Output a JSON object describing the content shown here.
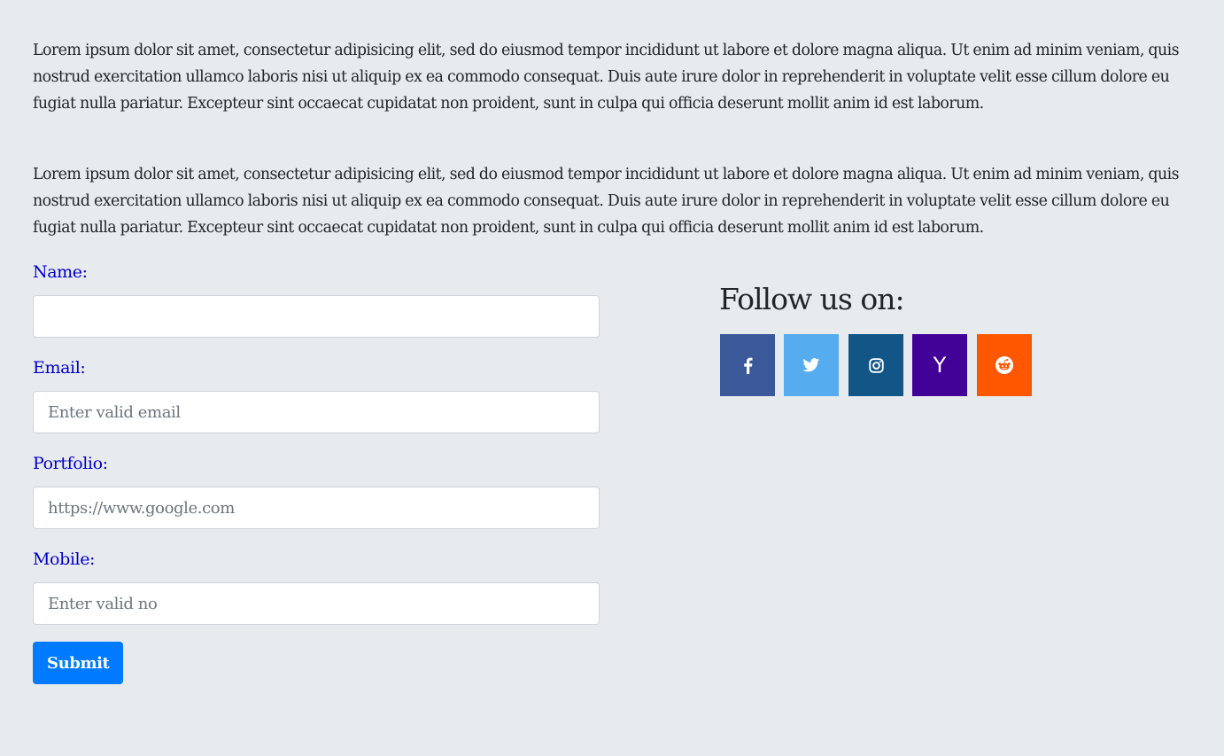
{
  "content": {
    "paragraph_1": "Lorem ipsum dolor sit amet, consectetur adipisicing elit, sed do eiusmod tempor incididunt ut labore et dolore magna aliqua. Ut enim ad minim veniam, quis nostrud exercitation ullamco laboris nisi ut aliquip ex ea commodo consequat. Duis aute irure dolor in reprehenderit in voluptate velit esse cillum dolore eu fugiat nulla pariatur. Excepteur sint occaecat cupidatat non proident, sunt in culpa qui officia deserunt mollit anim id est laborum.",
    "paragraph_2": "Lorem ipsum dolor sit amet, consectetur adipisicing elit, sed do eiusmod tempor incididunt ut labore et dolore magna aliqua. Ut enim ad minim veniam, quis nostrud exercitation ullamco laboris nisi ut aliquip ex ea commodo consequat. Duis aute irure dolor in reprehenderit in voluptate velit esse cillum dolore eu fugiat nulla pariatur. Excepteur sint occaecat cupidatat non proident, sunt in culpa qui officia deserunt mollit anim id est laborum."
  },
  "form": {
    "name": {
      "label": "Name:",
      "value": "",
      "placeholder": ""
    },
    "email": {
      "label": "Email:",
      "value": "",
      "placeholder": "Enter valid email"
    },
    "portfolio": {
      "label": "Portfolio:",
      "value": "",
      "placeholder": "https://www.google.com"
    },
    "mobile": {
      "label": "Mobile:",
      "value": "",
      "placeholder": "Enter valid no"
    },
    "submit_label": "Submit"
  },
  "social": {
    "heading": "Follow us on:",
    "buttons": [
      {
        "icon": "facebook-icon",
        "color": "#3b5998"
      },
      {
        "icon": "twitter-icon",
        "color": "#55acee"
      },
      {
        "icon": "instagram-icon",
        "color": "#125688"
      },
      {
        "icon": "yahoo-icon",
        "color": "#430297",
        "glyph": "Y"
      },
      {
        "icon": "reddit-icon",
        "color": "#ff5700"
      }
    ]
  },
  "colors": {
    "background": "#e8ebee",
    "label": "#0000cc",
    "primary": "#007bff"
  }
}
